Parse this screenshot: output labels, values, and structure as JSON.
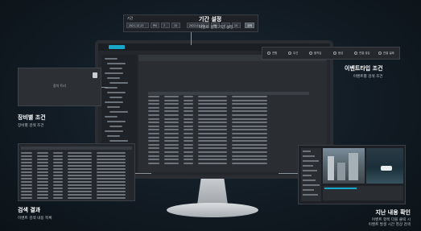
{
  "date_range": {
    "label": "기간",
    "start_date": "2021-12-27",
    "start_ampm": "PM",
    "start_hour": "7",
    "start_min": "15",
    "end_date": "2022-01-27",
    "end_ampm": "PM",
    "end_hour": "7",
    "end_min": "15",
    "search_button": "검색"
  },
  "event_types": [
    "전원",
    "무선",
    "움직임",
    "음성",
    "연결 끊김",
    "연결 실패"
  ],
  "device_panel": {
    "text": "장치 트리"
  },
  "callouts": {
    "period": {
      "title": "기간 설정",
      "subtitle": "이벤트 검색 기간 설정"
    },
    "event_type": {
      "title": "이벤트타입 조건",
      "subtitle": "이벤트별 검색 조건"
    },
    "device": {
      "title": "장비별 조건",
      "subtitle": "장비별 검색 조건"
    },
    "results": {
      "title": "검색 결과",
      "subtitle": "이벤트 검색 내용 목록"
    },
    "history": {
      "title": "지난 내용 확인",
      "subtitle_line1": "이벤트 항목 더블 클릭 시",
      "subtitle_line2": "이벤트 발생 시간 영상 검색"
    }
  },
  "colors": {
    "accent": "#19a7c9",
    "background": "#101820"
  }
}
